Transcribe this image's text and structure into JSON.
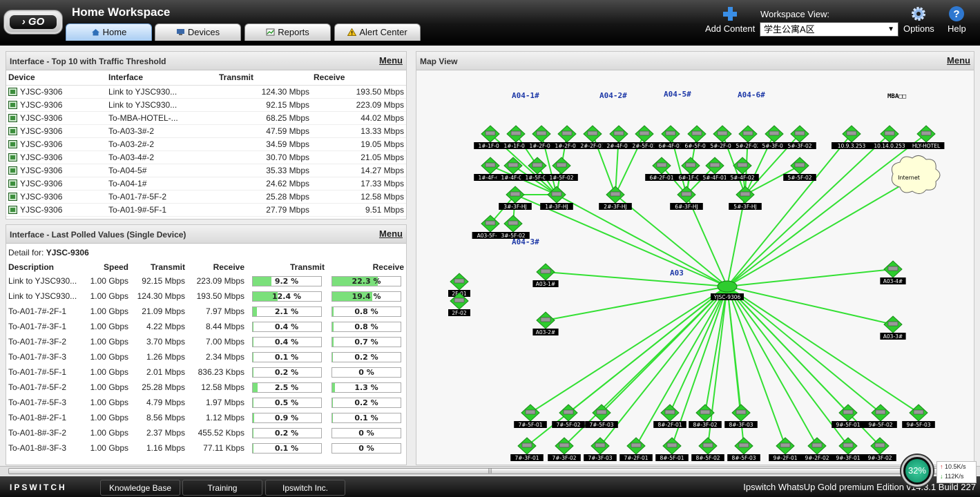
{
  "header": {
    "go_label": "GO",
    "workspace_title": "Home Workspace",
    "tabs": [
      {
        "label": "Home"
      },
      {
        "label": "Devices"
      },
      {
        "label": "Reports"
      },
      {
        "label": "Alert Center"
      }
    ],
    "add_content": "Add Content",
    "workspace_view_label": "Workspace View:",
    "workspace_view_value": "学生公寓A区",
    "options": "Options",
    "help": "Help"
  },
  "top10": {
    "title": "Interface - Top 10 with Traffic Threshold",
    "menu": "Menu",
    "columns": [
      "Device",
      "Interface",
      "Transmit",
      "Receive"
    ],
    "rows": [
      [
        "YJSC-9306",
        "Link to YJSC930...",
        "124.30 Mbps",
        "193.50 Mbps"
      ],
      [
        "YJSC-9306",
        "Link to YJSC930...",
        "92.15 Mbps",
        "223.09 Mbps"
      ],
      [
        "YJSC-9306",
        "To-MBA-HOTEL-...",
        "68.25 Mbps",
        "44.02 Mbps"
      ],
      [
        "YJSC-9306",
        "To-A03-3#-2",
        "47.59 Mbps",
        "13.33 Mbps"
      ],
      [
        "YJSC-9306",
        "To-A03-2#-2",
        "34.59 Mbps",
        "19.05 Mbps"
      ],
      [
        "YJSC-9306",
        "To-A03-4#-2",
        "30.70 Mbps",
        "21.05 Mbps"
      ],
      [
        "YJSC-9306",
        "To-A04-5#",
        "35.33 Mbps",
        "14.27 Mbps"
      ],
      [
        "YJSC-9306",
        "To-A04-1#",
        "24.62 Mbps",
        "17.33 Mbps"
      ],
      [
        "YJSC-9306",
        "To-A01-7#-5F-2",
        "25.28 Mbps",
        "12.58 Mbps"
      ],
      [
        "YJSC-9306",
        "To-A01-9#-5F-1",
        "27.79 Mbps",
        "9.51 Mbps"
      ]
    ]
  },
  "polled": {
    "title": "Interface - Last Polled Values (Single Device)",
    "menu": "Menu",
    "detail_label": "Detail for:",
    "detail_device": "YJSC-9306",
    "columns": [
      "Description",
      "Speed",
      "Transmit",
      "Receive",
      "Transmit",
      "Receive"
    ],
    "rows": [
      {
        "desc": "Link to YJSC930...",
        "speed": "1.00 Gbps",
        "tx": "92.15 Mbps",
        "rx": "223.09 Mbps",
        "txp": "9.2 %",
        "txv": 9.2,
        "rxp": "22.3 %",
        "rxv": 22.3
      },
      {
        "desc": "Link to YJSC930...",
        "speed": "1.00 Gbps",
        "tx": "124.30 Mbps",
        "rx": "193.50 Mbps",
        "txp": "12.4 %",
        "txv": 12.4,
        "rxp": "19.4 %",
        "rxv": 19.4
      },
      {
        "desc": "To-A01-7#-2F-1",
        "speed": "1.00 Gbps",
        "tx": "21.09 Mbps",
        "rx": "7.97 Mbps",
        "txp": "2.1 %",
        "txv": 2.1,
        "rxp": "0.8 %",
        "rxv": 0.8
      },
      {
        "desc": "To-A01-7#-3F-1",
        "speed": "1.00 Gbps",
        "tx": "4.22 Mbps",
        "rx": "8.44 Mbps",
        "txp": "0.4 %",
        "txv": 0.4,
        "rxp": "0.8 %",
        "rxv": 0.8
      },
      {
        "desc": "To-A01-7#-3F-2",
        "speed": "1.00 Gbps",
        "tx": "3.70 Mbps",
        "rx": "7.00 Mbps",
        "txp": "0.4 %",
        "txv": 0.4,
        "rxp": "0.7 %",
        "rxv": 0.7
      },
      {
        "desc": "To-A01-7#-3F-3",
        "speed": "1.00 Gbps",
        "tx": "1.26 Mbps",
        "rx": "2.34 Mbps",
        "txp": "0.1 %",
        "txv": 0.1,
        "rxp": "0.2 %",
        "rxv": 0.2
      },
      {
        "desc": "To-A01-7#-5F-1",
        "speed": "1.00 Gbps",
        "tx": "2.01 Mbps",
        "rx": "836.23 Kbps",
        "txp": "0.2 %",
        "txv": 0.2,
        "rxp": "0 %",
        "rxv": 0
      },
      {
        "desc": "To-A01-7#-5F-2",
        "speed": "1.00 Gbps",
        "tx": "25.28 Mbps",
        "rx": "12.58 Mbps",
        "txp": "2.5 %",
        "txv": 2.5,
        "rxp": "1.3 %",
        "rxv": 1.3
      },
      {
        "desc": "To-A01-7#-5F-3",
        "speed": "1.00 Gbps",
        "tx": "4.79 Mbps",
        "rx": "1.97 Mbps",
        "txp": "0.5 %",
        "txv": 0.5,
        "rxp": "0.2 %",
        "rxv": 0.2
      },
      {
        "desc": "To-A01-8#-2F-1",
        "speed": "1.00 Gbps",
        "tx": "8.56 Mbps",
        "rx": "1.12 Mbps",
        "txp": "0.9 %",
        "txv": 0.9,
        "rxp": "0.1 %",
        "rxv": 0.1
      },
      {
        "desc": "To-A01-8#-3F-2",
        "speed": "1.00 Gbps",
        "tx": "2.37 Mbps",
        "rx": "455.52 Kbps",
        "txp": "0.2 %",
        "txv": 0.2,
        "rxp": "0 %",
        "rxv": 0
      },
      {
        "desc": "To-A01-8#-3F-3",
        "speed": "1.00 Gbps",
        "tx": "1.16 Mbps",
        "rx": "77.11 Kbps",
        "txp": "0.1 %",
        "txv": 0.1,
        "rxp": "0 %",
        "rxv": 0
      }
    ]
  },
  "map": {
    "title": "Map View",
    "menu": "Menu",
    "group_labels": [
      "A04-1#",
      "A04-2#",
      "A04-5#",
      "A04-6#",
      "A04-3#",
      "A03",
      "MBA□□"
    ],
    "core": "YJSC-9306",
    "cloud": "Internet",
    "nodes_top": [
      "1#-1F-01",
      "1#-1F-02",
      "1#-2F-01",
      "1#-2F-02",
      "2#-2F-01",
      "2#-4F-01",
      "2#-5F-01",
      "6#-4F-01",
      "6#-5F-01",
      "5#-2F-01",
      "5#-2F-02",
      "5#-3F-01",
      "5#-3F-02"
    ],
    "nodes_row2": [
      "1#-4F-01",
      "1#-4F-02",
      "1#-5F-01",
      "1#-5F-02",
      "6#-2F-01",
      "6#-1F-01",
      "5#-4F-01",
      "5#-4F-02",
      "5#-5F-02"
    ],
    "nodes_row3": [
      "3#-3F-HJ",
      "1#-3F-HJ",
      "2#-3F-HJ",
      "6#-3F-HJ",
      "5#-3F-HJ"
    ],
    "nodes_row4": [
      "A03-5F-01",
      "3#-5F-02"
    ],
    "nodes_mba": [
      "10.9.3.253",
      "10.14.0.253",
      "HLY-HOTEL"
    ],
    "nodes_left": [
      "2F-01",
      "2F-02"
    ],
    "nodes_a03": [
      "A03-1#",
      "A03-2#",
      "A03-4#",
      "A03-3#"
    ],
    "nodes_bottom1": [
      "7#-5F-01",
      "7#-5F-02",
      "7#-5F-03",
      "8#-2F-01",
      "8#-3F-02",
      "8#-3F-03",
      "9#-5F-01",
      "9#-5F-02",
      "9#-5F-03"
    ],
    "nodes_bottom2": [
      "7#-3F-01",
      "7#-3F-02",
      "7#-3F-03",
      "7#-2F-01",
      "8#-5F-01",
      "8#-5F-02",
      "8#-5F-03",
      "9#-2F-01",
      "9#-2F-02",
      "9#-3F-01",
      "9#-3F-02"
    ]
  },
  "footer": {
    "logo": "IPSWITCH",
    "links": [
      "Knowledge Base",
      "Training",
      "Ipswitch Inc."
    ],
    "version": "Ipswitch WhatsUp Gold premium Edition v14.3.1 Build 227",
    "gauge": "32%",
    "up_speed": "10.5K/s",
    "down_speed": "112K/s"
  },
  "colors": {
    "link_green": "#33e033",
    "node_green": "#2ecc2e",
    "bar_green": "#7be07b",
    "group_label": "#1f3aa8"
  }
}
